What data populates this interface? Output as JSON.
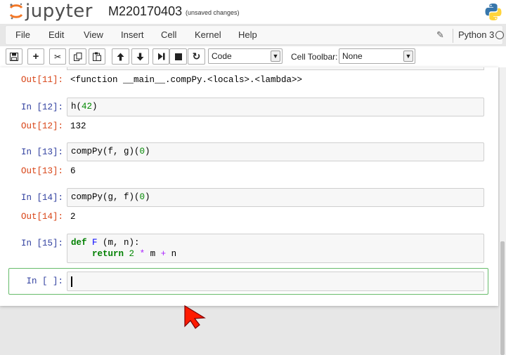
{
  "header": {
    "logo_text": "jupyter",
    "notebook_name": "M220170403",
    "save_status": "(unsaved changes)"
  },
  "menu": {
    "items": [
      "File",
      "Edit",
      "View",
      "Insert",
      "Cell",
      "Kernel",
      "Help"
    ],
    "kernel_name": "Python 3"
  },
  "toolbar": {
    "cell_type": "Code",
    "cell_toolbar_label": "Cell Toolbar:",
    "cell_toolbar_value": "None"
  },
  "cells": [
    {
      "out_prompt": "Out[11]:",
      "output": "<function __main__.compPy.<locals>.<lambda>>"
    },
    {
      "in_prompt": "In [12]:",
      "code": "h(42)",
      "out_prompt": "Out[12]:",
      "output": "132"
    },
    {
      "in_prompt": "In [13]:",
      "code": "compPy(f, g)(0)",
      "out_prompt": "Out[13]:",
      "output": "6"
    },
    {
      "in_prompt": "In [14]:",
      "code": "compPy(g, f)(0)",
      "out_prompt": "Out[14]:",
      "output": "2"
    },
    {
      "in_prompt": "In [15]:",
      "code_line1": "def F (m, n):",
      "code_line2": "    return 2 * m + n"
    },
    {
      "in_prompt": "In [ ]:",
      "code": ""
    }
  ],
  "colors": {
    "in_prompt": "#303f9f",
    "out_prompt": "#d84315",
    "active_border": "#66bb6a",
    "pointer": "#ff1a00"
  }
}
